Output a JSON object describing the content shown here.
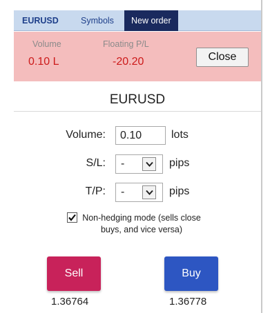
{
  "tabs": [
    {
      "label": "EURUSD"
    },
    {
      "label": "Symbols"
    },
    {
      "label": "New order",
      "active": true
    }
  ],
  "position": {
    "volume_label": "Volume",
    "volume_value": "0.10 L",
    "pl_label": "Floating P/L",
    "pl_value": "-20.20",
    "close_label": "Close"
  },
  "symbol": "EURUSD",
  "form": {
    "volume_label": "Volume:",
    "volume_value": "0.10",
    "volume_unit": "lots",
    "sl_label": "S/L:",
    "sl_value": "-",
    "sl_unit": "pips",
    "tp_label": "T/P:",
    "tp_value": "-",
    "tp_unit": "pips",
    "non_hedging_checked": true,
    "non_hedging_text": "Non-hedging mode (sells close buys, and vice versa)"
  },
  "trade": {
    "sell_label": "Sell",
    "buy_label": "Buy",
    "sell_price": "1.36764",
    "buy_price": "1.36778"
  },
  "colors": {
    "tabbar_bg": "#c8d9ee",
    "active_tab_bg": "#1a2a5e",
    "banner_bg": "#f4bdbd",
    "loss_text": "#cc1a1a",
    "sell_bg": "#c8225a",
    "buy_bg": "#2d56c2"
  }
}
